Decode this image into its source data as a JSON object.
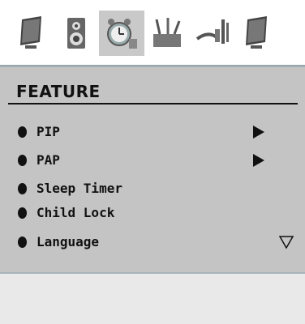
{
  "tabs": [
    {
      "icon": "display-icon",
      "active": false
    },
    {
      "icon": "speaker-icon",
      "active": false
    },
    {
      "icon": "alarm-clock-icon",
      "active": true
    },
    {
      "icon": "tools-icon",
      "active": false
    },
    {
      "icon": "cable-connector-icon",
      "active": false
    },
    {
      "icon": "display-icon",
      "active": false
    }
  ],
  "menu": {
    "title": "FEATURE",
    "items": [
      {
        "label": "PIP",
        "indicator": "submenu-arrow"
      },
      {
        "label": "PAP",
        "indicator": "submenu-arrow"
      },
      {
        "label": "Sleep Timer",
        "indicator": ""
      },
      {
        "label": "Child Lock",
        "indicator": ""
      },
      {
        "label": "Language",
        "indicator": "scroll-down-arrow"
      }
    ]
  },
  "colors": {
    "panel": "#c4c4c4",
    "text": "#111111",
    "active_tab": "#c9c9c9"
  }
}
